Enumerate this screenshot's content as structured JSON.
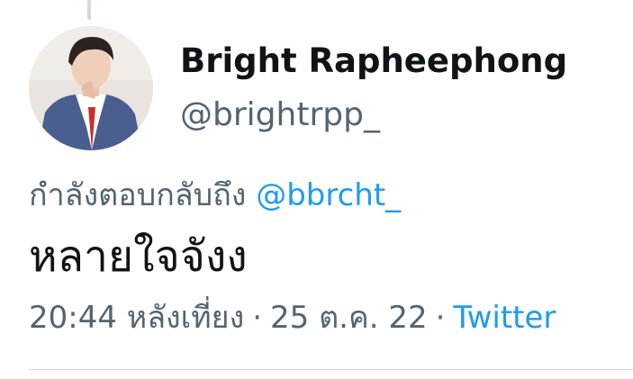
{
  "user": {
    "display_name": "Bright Rapheephong",
    "handle": "@brightrpp_"
  },
  "reply": {
    "prefix": "กำลังตอบกลับถึง",
    "mention": "@bbrcht_"
  },
  "tweet": {
    "text": "หลายใจจังง",
    "time": "20:44 หลังเที่ยง",
    "separator": "·",
    "date": "25 ต.ค. 22",
    "source": "Twitter"
  },
  "colors": {
    "accent": "#1d9bf0",
    "text_primary": "#0f1419",
    "text_secondary": "#536471",
    "divider": "#cfd9de"
  }
}
